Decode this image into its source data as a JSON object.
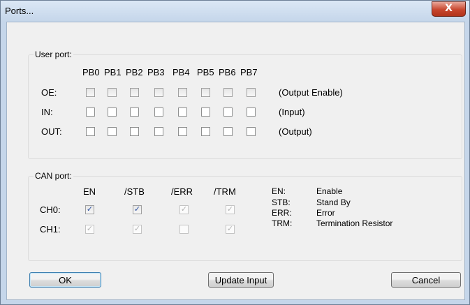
{
  "window": {
    "title": "Ports...",
    "close_glyph": "X"
  },
  "user_port": {
    "label": "User port:",
    "columns": [
      "PB0",
      "PB1",
      "PB2",
      "PB3",
      "PB4",
      "PB5",
      "PB6",
      "PB7"
    ],
    "rows": [
      {
        "label": "OE:",
        "desc": "(Output Enable)",
        "checked": [
          false,
          false,
          false,
          false,
          false,
          false,
          false,
          false
        ]
      },
      {
        "label": "IN:",
        "desc": "(Input)",
        "checked": [
          false,
          false,
          false,
          false,
          false,
          false,
          false,
          false
        ]
      },
      {
        "label": "OUT:",
        "desc": "(Output)",
        "checked": [
          false,
          false,
          false,
          false,
          false,
          false,
          false,
          false
        ]
      }
    ]
  },
  "can_port": {
    "label": "CAN port:",
    "columns": [
      "EN",
      "/STB",
      "/ERR",
      "/TRM"
    ],
    "rows": [
      {
        "label": "CH0:",
        "checked": [
          true,
          true,
          true,
          true
        ],
        "enabled": [
          true,
          true,
          false,
          false
        ]
      },
      {
        "label": "CH1:",
        "checked": [
          true,
          true,
          false,
          true
        ],
        "enabled": [
          false,
          false,
          false,
          false
        ]
      }
    ],
    "legend": [
      {
        "abbr": "EN:",
        "meaning": "Enable"
      },
      {
        "abbr": "STB:",
        "meaning": "Stand By"
      },
      {
        "abbr": "ERR:",
        "meaning": "Error"
      },
      {
        "abbr": "TRM:",
        "meaning": "Termination Resistor"
      }
    ]
  },
  "buttons": {
    "ok": "OK",
    "update_input": "Update Input",
    "cancel": "Cancel"
  },
  "check_glyph": "✓"
}
